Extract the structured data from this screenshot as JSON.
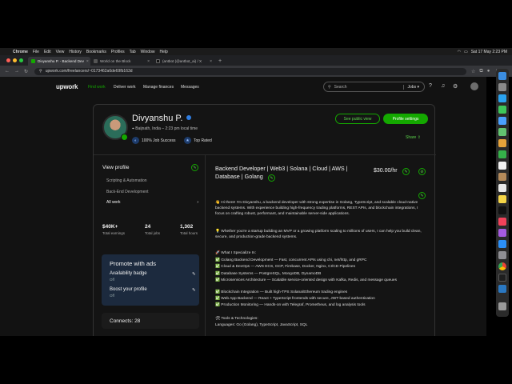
{
  "menubar": {
    "items": [
      "Chrome",
      "File",
      "Edit",
      "View",
      "History",
      "Bookmarks",
      "Profiles",
      "Tab",
      "Window",
      "Help"
    ],
    "datetime": "Sat 17 May 2:23 PM"
  },
  "tabs": [
    {
      "label": "Divyanshu P. - Backend Dev"
    },
    {
      "label": "World on the Block"
    },
    {
      "label": "(antbot (@antbot_ai) / X"
    }
  ],
  "address": {
    "url": "upwork.com/freelancers/~0173462a6de69fb163d"
  },
  "upwork_nav": {
    "logo": "upwork",
    "links": [
      "Find work",
      "Deliver work",
      "Manage finances",
      "Messages"
    ],
    "search_placeholder": "Search",
    "search_scope": "Jobs"
  },
  "profile": {
    "name": "Divyanshu P.",
    "location": "Baijnath, India – 2:23 pm local time",
    "badges": [
      "100% Job Success",
      "Top Rated"
    ],
    "public_view_label": "See public view",
    "settings_label": "Profile settings",
    "share_label": "Share"
  },
  "left": {
    "view_profile": "View profile",
    "specialties": [
      "Scripting & Automation",
      "Back-End Development",
      "All work"
    ],
    "stats": [
      {
        "value": "$40K+",
        "label": "Total earnings"
      },
      {
        "value": "24",
        "label": "Total jobs"
      },
      {
        "value": "1,302",
        "label": "Total hours"
      }
    ],
    "promo": {
      "title": "Promote with ads",
      "items": [
        {
          "label": "Availability badge",
          "state": "Off"
        },
        {
          "label": "Boost your profile",
          "state": "Off"
        }
      ]
    },
    "connects": "Connects: 28"
  },
  "right": {
    "title": "Backend Developer | Web3 | Solana | Cloud | AWS | Database | Golang",
    "rate": "$30.00/hr",
    "intro": "👋 Hi there! I'm Divyanshu, a backend developer with strong expertise in Golang, TypeScript, and scalable cloud-native backend systems. With experience building high-frequency trading platforms, REST APIs, and blockchain integrations, I focus on crafting robust, performant, and maintainable server-side applications.",
    "mvp": "💡 Whether you're a startup building an MVP or a growing platform scaling to millions of users, I can help you build clean, secure, and production-grade backend systems.",
    "specialize_title": "🚀 What I Specialize In:",
    "specialize": [
      "✅ Golang Backend Development — Fast, concurrent APIs using chi, net/http, and gRPC",
      "✅ Cloud & DevOps — AWS ECS, GCP, Firebase, Docker, Nginx, CI/CD Pipelines",
      "✅ Database Systems — PostgreSQL, MongoDB, DynamoDB",
      "✅ Microservices Architecture — Scalable service-oriented design with Kafka, Redis, and message queues",
      "✅ Blockchain Integration — Built high-TPS Solana/Ethereum trading engines",
      "✅ Web App Backend — React + TypeScript frontends with secure, JWT-based authentication",
      "✅ Production Monitoring — Hands-on with Telegraf, Prometheus, and log analysis tools"
    ],
    "tools_title": "🛠 Tools & Technologies:",
    "languages": "Languages: Go (Golang), TypeScript, JavaScript, SQL"
  }
}
